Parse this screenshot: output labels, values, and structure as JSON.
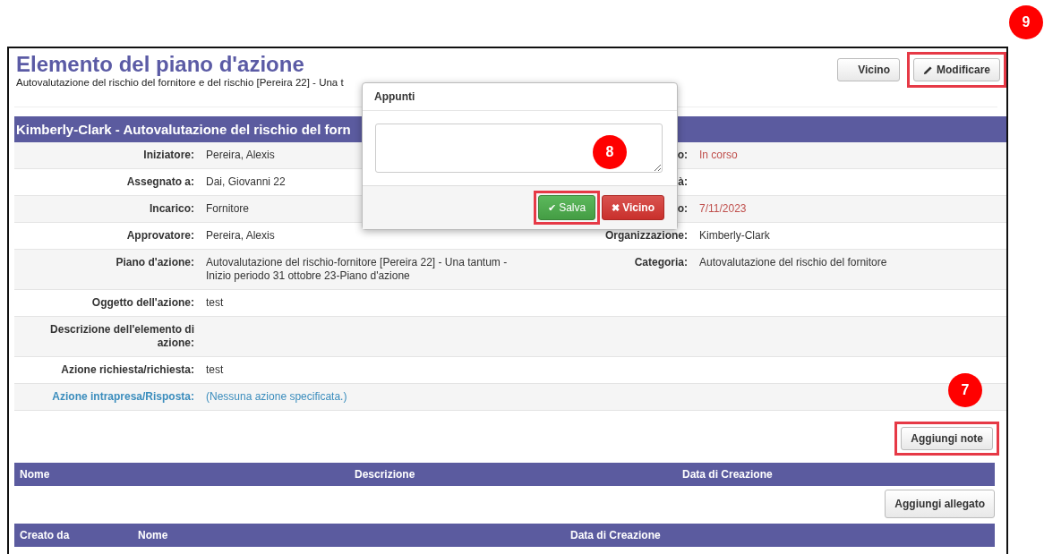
{
  "page": {
    "title": "Elemento del piano d'azione",
    "subtitle": "Autovalutazione del rischio del fornitore e del rischio [Pereira 22] - Una t"
  },
  "top_buttons": [
    {
      "label": "Vicino",
      "kind": "close",
      "highlighted": false
    },
    {
      "label": "Modificare",
      "kind": "edit",
      "highlighted": true,
      "callout": "9"
    }
  ],
  "header_bar": {
    "title": "Kimberly-Clark - Autovalutazione del rischio del forn"
  },
  "fields": [
    {
      "label": "Iniziatore:",
      "value": "Pereira, Alexis",
      "kind": "plain",
      "right": {
        "label": "o:",
        "value": "In corso",
        "kind": "alert"
      }
    },
    {
      "label": "Assegnato a:",
      "value": "Dai, Giovanni 22",
      "kind": "plain",
      "right": {
        "label": "à:",
        "kind": "plain"
      }
    },
    {
      "label": "Incarico:",
      "value": "Fornitore",
      "kind": "plain",
      "right": {
        "label": "o:",
        "value": "7/11/2023",
        "kind": "alert"
      }
    },
    {
      "label": "Approvatore:",
      "value": "Pereira, Alexis",
      "kind": "plain",
      "right": {
        "label": "Organizzazione:",
        "value": "Kimberly-Clark",
        "kind": "plain"
      }
    },
    {
      "label": "Piano d'azione:",
      "value": "Autovalutazione del rischio-fornitore [Pereira 22] - Una tantum - Inizio periodo 31 ottobre 23-Piano d'azione",
      "kind": "plain",
      "right": {
        "label": "Categoria:",
        "value": "Autovalutazione del rischio del fornitore",
        "kind": "plain"
      }
    },
    {
      "label": "Oggetto dell'azione:",
      "value": "test",
      "kind": "plain"
    },
    {
      "label": "Descrizione dell'elemento di azione:",
      "kind": "plain"
    },
    {
      "label": "Azione richiesta/richiesta:",
      "value": "test",
      "kind": "plain"
    },
    {
      "label": "Azione intrapresa/Risposta:",
      "value": "(Nessuna azione specificata.)",
      "kind": "link"
    }
  ],
  "notes": {
    "button": {
      "label": "Aggiungi note",
      "highlighted": true,
      "callout": "7"
    },
    "columns": [
      "Nome",
      "Descrizione",
      "Data di Creazione"
    ]
  },
  "attachments": {
    "button": {
      "label": "Aggiungi allegato"
    },
    "columns": [
      "Creato da",
      "Nome",
      "Data di Creazione"
    ]
  },
  "modal": {
    "title": "Appunti",
    "callout": "8",
    "buttons": [
      {
        "label": "Salva",
        "icon": "✔",
        "kind": "save",
        "highlighted": true
      },
      {
        "label": "Vicino",
        "icon": "✖",
        "kind": "close",
        "highlighted": false
      }
    ]
  }
}
